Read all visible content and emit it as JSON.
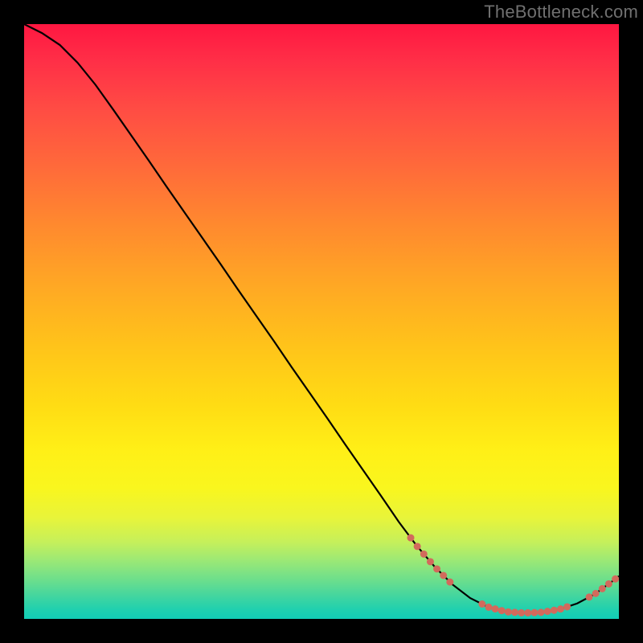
{
  "watermark": "TheBottleneck.com",
  "chart_data": {
    "type": "line",
    "title": "",
    "xlabel": "",
    "ylabel": "",
    "xlim": [
      0,
      100
    ],
    "ylim": [
      0,
      100
    ],
    "grid": false,
    "legend": false,
    "curve_xy": [
      [
        0,
        100.0
      ],
      [
        3,
        98.5
      ],
      [
        6,
        96.5
      ],
      [
        9,
        93.5
      ],
      [
        12,
        89.8
      ],
      [
        15,
        85.6
      ],
      [
        18,
        81.3
      ],
      [
        21,
        77.0
      ],
      [
        24,
        72.6
      ],
      [
        27,
        68.3
      ],
      [
        30,
        64.0
      ],
      [
        33,
        59.7
      ],
      [
        36,
        55.3
      ],
      [
        39,
        51.0
      ],
      [
        42,
        46.7
      ],
      [
        45,
        42.3
      ],
      [
        48,
        38.0
      ],
      [
        51,
        33.7
      ],
      [
        54,
        29.3
      ],
      [
        57,
        25.0
      ],
      [
        60,
        20.7
      ],
      [
        63,
        16.3
      ],
      [
        66,
        12.3
      ],
      [
        69,
        8.8
      ],
      [
        72,
        5.8
      ],
      [
        75,
        3.5
      ],
      [
        78,
        2.0
      ],
      [
        81,
        1.2
      ],
      [
        84,
        1.0
      ],
      [
        87,
        1.1
      ],
      [
        90,
        1.6
      ],
      [
        93,
        2.6
      ],
      [
        96,
        4.2
      ],
      [
        99,
        6.4
      ],
      [
        100,
        7.2
      ]
    ],
    "dotted_segments_x": [
      [
        65,
        72
      ],
      [
        77,
        92
      ],
      [
        95,
        100
      ]
    ],
    "marker_color": "#d26a5c",
    "line_color": "#000000"
  }
}
